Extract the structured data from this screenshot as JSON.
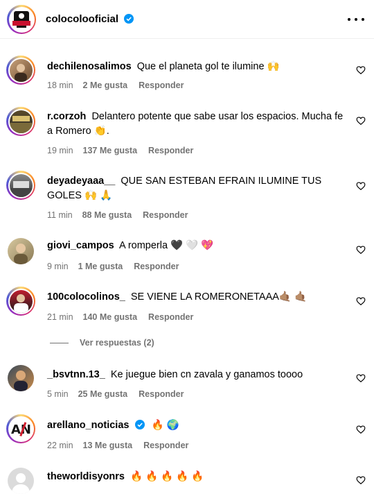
{
  "post": {
    "username": "colocolooficial"
  },
  "comments": [
    {
      "user": "dechilenosalimos",
      "text": "Que el planeta gol te ilumine 🙌",
      "time": "18 min",
      "likes": "2 Me gusta",
      "reply": "Responder"
    },
    {
      "user": "r.corzoh",
      "text": "Delantero potente que sabe usar los espacios. Mucha fe a Romero 👏.",
      "time": "19 min",
      "likes": "137 Me gusta",
      "reply": "Responder"
    },
    {
      "user": "deyadeyaaa__",
      "text": "QUE SAN ESTEBAN EFRAIN ILUMINE TUS GOLES 🙌 🙏",
      "time": "11 min",
      "likes": "88 Me gusta",
      "reply": "Responder"
    },
    {
      "user": "giovi_campos",
      "text": "A romperla 🖤 🤍 💖",
      "time": "9 min",
      "likes": "1 Me gusta",
      "reply": "Responder"
    },
    {
      "user": "100colocolinos_",
      "text": "SE VIENE LA ROMERONETAAA🤙🏽 🤙🏽",
      "time": "21 min",
      "likes": "140 Me gusta",
      "reply": "Responder"
    },
    {
      "user": "_bsvtnn.13_",
      "text": "Ke juegue bien cn zavala y ganamos toooo",
      "time": "5 min",
      "likes": "25 Me gusta",
      "reply": "Responder"
    },
    {
      "user": "arellano_noticias",
      "text": "🔥 🌍",
      "time": "22 min",
      "likes": "13 Me gusta",
      "reply": "Responder"
    },
    {
      "user": "theworldisyonrs",
      "text": "🔥 🔥 🔥 🔥 🔥"
    }
  ],
  "replies_toggle": "Ver respuestas (2)",
  "colors": {
    "verified": "#0095f6",
    "meta": "#737373"
  },
  "icons": {
    "more": "more-options-icon",
    "like": "heart-icon",
    "verified": "verified-badge-icon"
  }
}
